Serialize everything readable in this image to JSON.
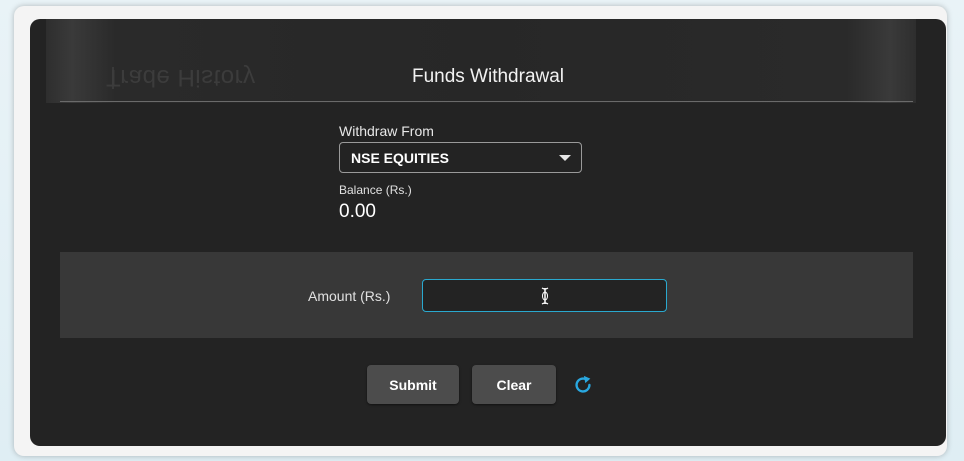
{
  "background_title": "Trade History",
  "dialog": {
    "title": "Funds Withdrawal",
    "withdraw_from_label": "Withdraw From",
    "withdraw_from_value": "NSE EQUITIES",
    "balance_label": "Balance (Rs.)",
    "balance_value": "0.00",
    "amount_label": "Amount (Rs.)",
    "amount_value": "",
    "submit_label": "Submit",
    "clear_label": "Clear"
  },
  "icons": {
    "dropdown": "caret-down-icon",
    "refresh": "refresh-icon",
    "cursor": "text-cursor-icon"
  },
  "colors": {
    "panel_bg": "#232323",
    "amount_band_bg": "#383838",
    "accent": "#2aa9cf",
    "button_bg": "#4c4c4c",
    "refresh_icon": "#29a8e0"
  }
}
